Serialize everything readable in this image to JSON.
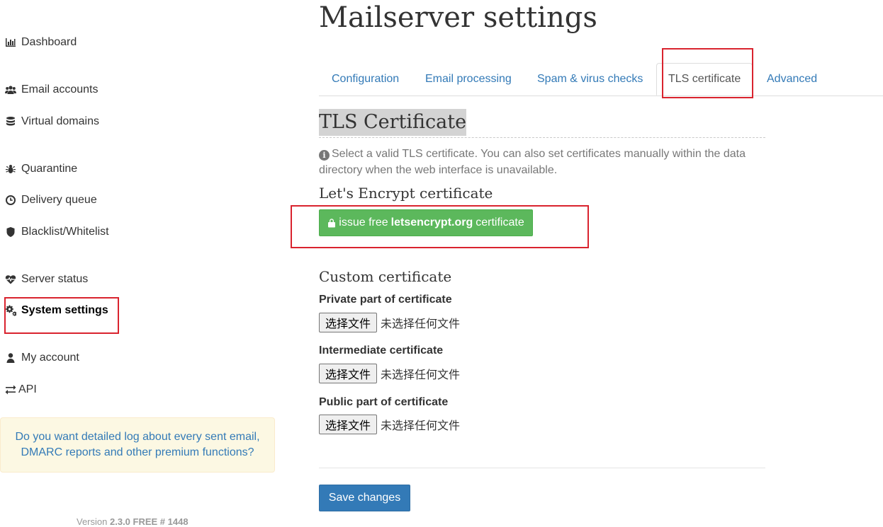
{
  "sidebar": {
    "items": [
      {
        "label": "Dashboard",
        "icon": "bar-chart-icon"
      },
      {
        "label": "Email accounts",
        "icon": "users-icon"
      },
      {
        "label": "Virtual domains",
        "icon": "database-icon"
      },
      {
        "label": "Quarantine",
        "icon": "bug-icon"
      },
      {
        "label": "Delivery queue",
        "icon": "clock-icon"
      },
      {
        "label": "Blacklist/Whitelist",
        "icon": "shield-icon"
      },
      {
        "label": "Server status",
        "icon": "heartbeat-icon"
      },
      {
        "label": "System settings",
        "icon": "gears-icon",
        "active": true
      },
      {
        "label": "My account",
        "icon": "user-icon"
      },
      {
        "label": "API",
        "icon": "exchange-icon"
      }
    ],
    "premium_text": "Do you want detailed log about every sent email, DMARC reports and other premium functions?",
    "version_prefix": "Version",
    "version_value": "2.3.0 FREE # 1448"
  },
  "page": {
    "title": "Mailserver settings"
  },
  "tabs": [
    {
      "label": "Configuration"
    },
    {
      "label": "Email processing"
    },
    {
      "label": "Spam & virus checks"
    },
    {
      "label": "TLS certificate",
      "active": true
    },
    {
      "label": "Advanced"
    }
  ],
  "tls": {
    "section_title": "TLS Certificate",
    "info_text": "Select a valid TLS certificate. You can also set certificates manually within the data directory when the web interface is unavailable.",
    "letsencrypt_title": "Let's Encrypt certificate",
    "letsencrypt_button_prefix": "issue free",
    "letsencrypt_button_domain": "letsencrypt.org",
    "letsencrypt_button_suffix": "certificate",
    "custom_title": "Custom certificate",
    "files": [
      {
        "label": "Private part of certificate",
        "button": "选择文件",
        "status": "未选择任何文件"
      },
      {
        "label": "Intermediate certificate",
        "button": "选择文件",
        "status": "未选择任何文件"
      },
      {
        "label": "Public part of certificate",
        "button": "选择文件",
        "status": "未选择任何文件"
      }
    ],
    "save_button": "Save changes"
  },
  "colors": {
    "link": "#337ab7",
    "success": "#5cb85c",
    "primary": "#337ab7",
    "highlight_box": "#d9232e",
    "premium_bg": "#fcf8e3"
  }
}
